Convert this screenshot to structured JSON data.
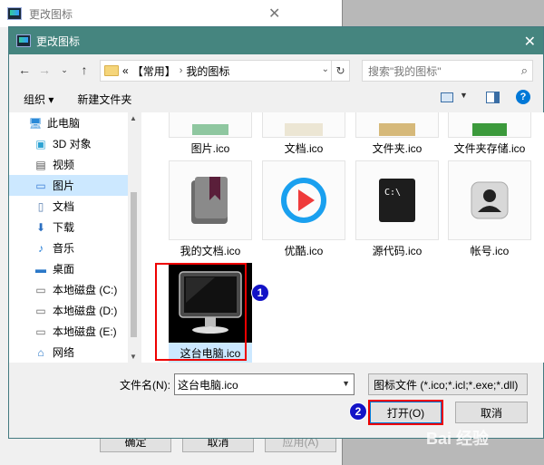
{
  "bg_window": {
    "title": "更改图标",
    "buttons": {
      "ok": "确定",
      "cancel": "取消",
      "apply": "应用(A)"
    }
  },
  "dialog": {
    "title": "更改图标",
    "address": {
      "overflow": "«",
      "crumbs": [
        "【常用】",
        "我的图标"
      ]
    },
    "search_placeholder": "搜索\"我的图标\"",
    "toolbar": {
      "organize": "组织 ▾",
      "new_folder": "新建文件夹",
      "help": "?"
    },
    "sidebar": [
      {
        "label": "此电脑",
        "icon": "computer-icon",
        "color": "#2b8ad8"
      },
      {
        "label": "3D 对象",
        "icon": "cube-icon",
        "color": "#2ea3d3"
      },
      {
        "label": "视频",
        "icon": "film-icon",
        "color": "#555555"
      },
      {
        "label": "图片",
        "icon": "picture-icon",
        "color": "#3a7bd5",
        "selected": true
      },
      {
        "label": "文档",
        "icon": "document-icon",
        "color": "#5a7fb0"
      },
      {
        "label": "下载",
        "icon": "download-icon",
        "color": "#2b6fc1"
      },
      {
        "label": "音乐",
        "icon": "music-icon",
        "color": "#1e7ad6"
      },
      {
        "label": "桌面",
        "icon": "desktop-icon",
        "color": "#2a78c8"
      },
      {
        "label": "本地磁盘 (C:)",
        "icon": "drive-icon",
        "color": "#666666"
      },
      {
        "label": "本地磁盘 (D:)",
        "icon": "drive-icon",
        "color": "#666666"
      },
      {
        "label": "本地磁盘 (E:)",
        "icon": "drive-icon",
        "color": "#666666"
      },
      {
        "label": "网络",
        "icon": "network-icon",
        "color": "#2a78c8"
      }
    ],
    "files": [
      {
        "label": "图片.ico",
        "icon": "picture-file-icon"
      },
      {
        "label": "文档.ico",
        "icon": "document-file-icon"
      },
      {
        "label": "文件夹.ico",
        "icon": "folder-file-icon"
      },
      {
        "label": "文件夹存储.ico",
        "icon": "folder-storage-icon"
      },
      {
        "label": "我的文档.ico",
        "icon": "my-documents-icon"
      },
      {
        "label": "优酷.ico",
        "icon": "youku-icon"
      },
      {
        "label": "源代码.ico",
        "icon": "console-icon"
      },
      {
        "label": "帐号.ico",
        "icon": "account-icon"
      },
      {
        "label": "这台电脑.ico",
        "icon": "monitor-icon",
        "selected": true
      }
    ],
    "footer": {
      "filename_label": "文件名(N):",
      "filename_value": "这台电脑.ico",
      "filter": "图标文件 (*.ico;*.icl;*.exe;*.dll)",
      "open": "打开(O)",
      "cancel": "取消"
    },
    "annotations": {
      "step1": "1",
      "step2": "2"
    },
    "watermark": "Bai 经验"
  }
}
